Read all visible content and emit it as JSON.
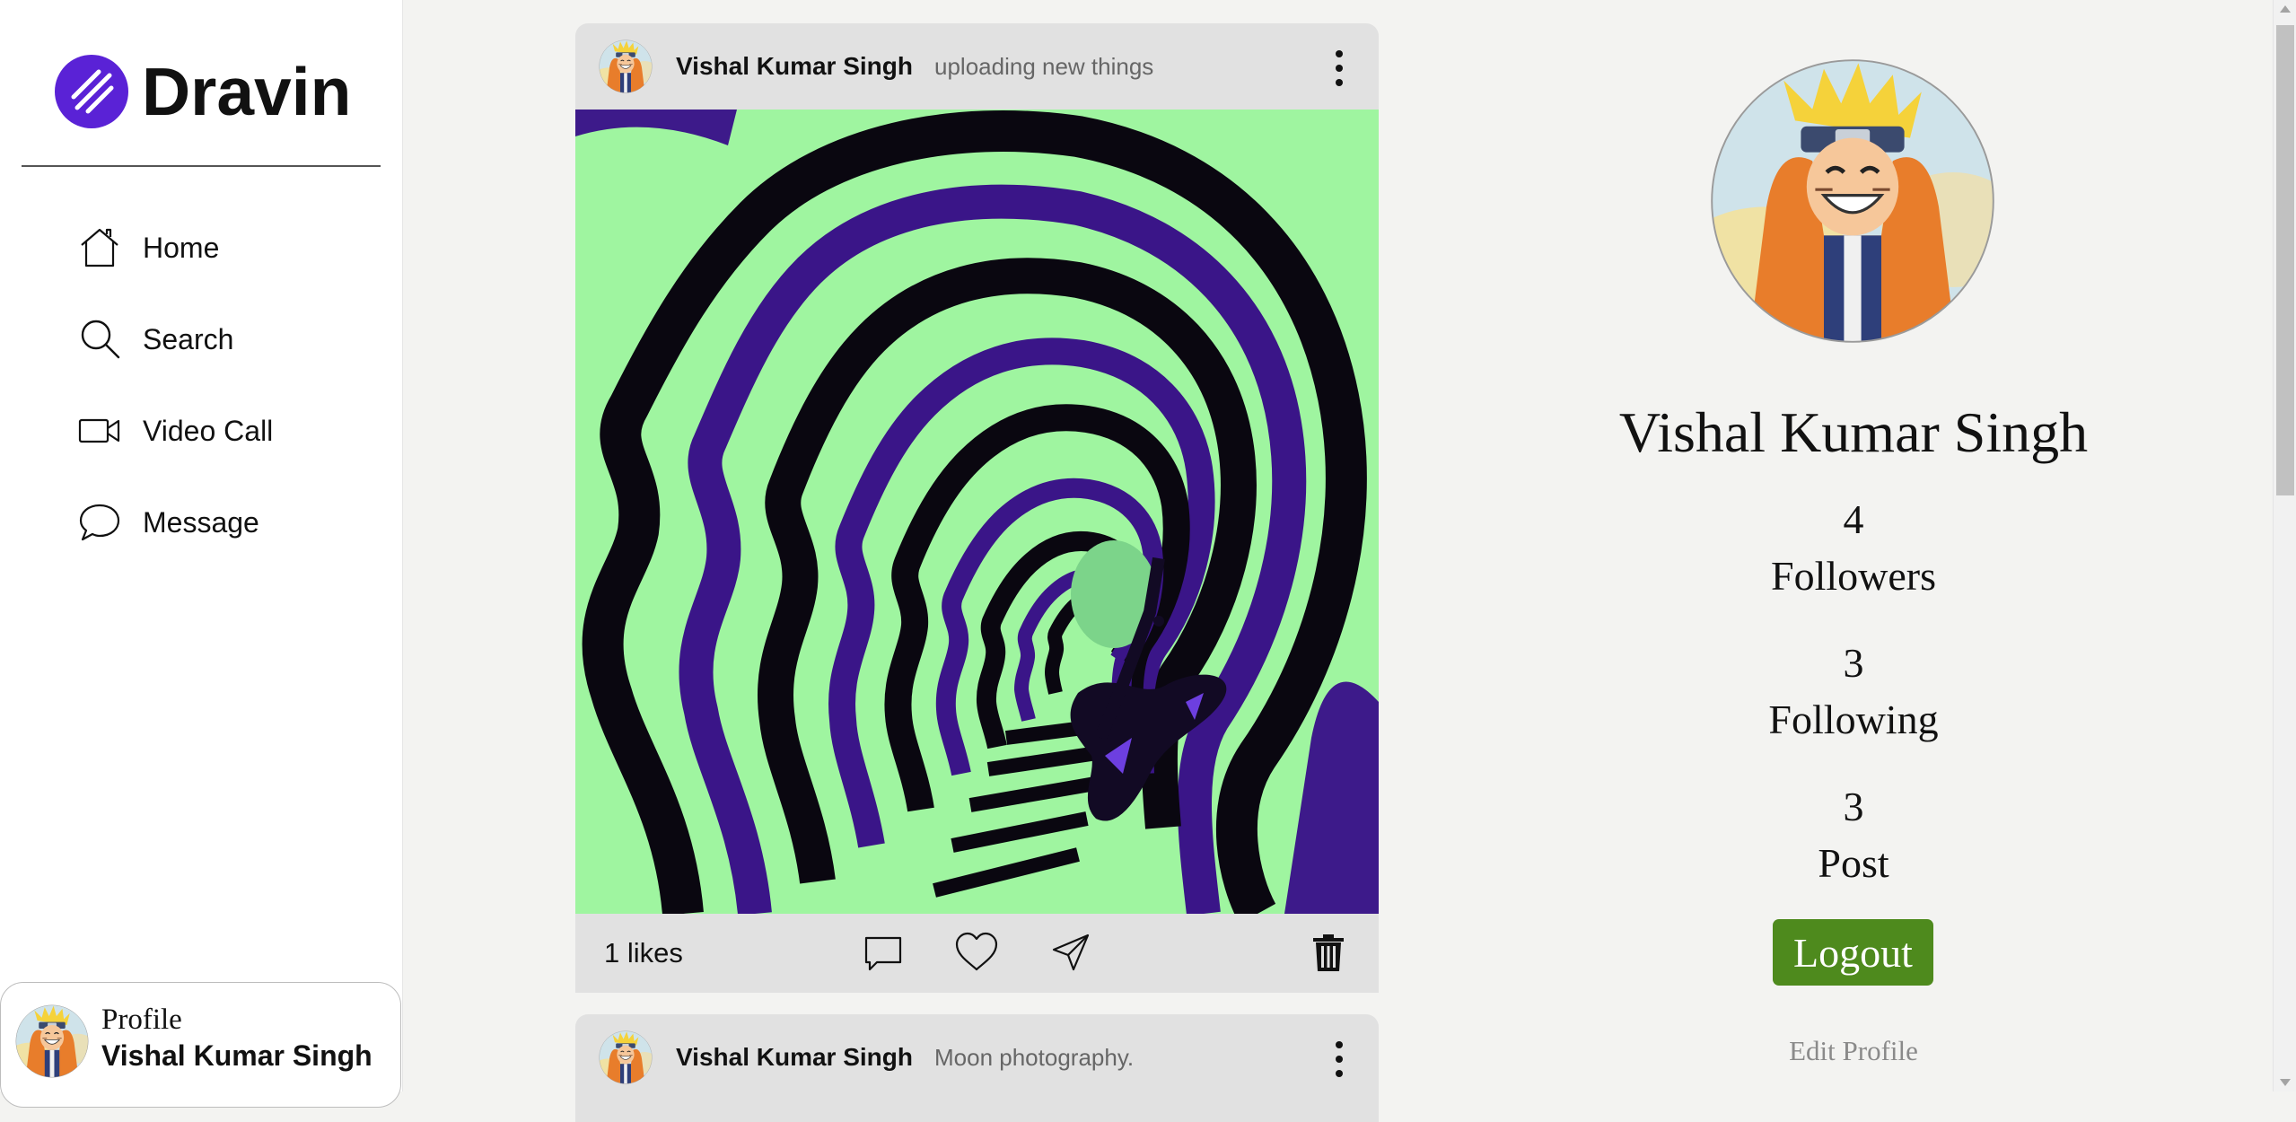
{
  "app": {
    "brand": "Dravin",
    "brand_color": "#5a22d6"
  },
  "sidebar": {
    "items": [
      {
        "icon": "home-icon",
        "label": "Home"
      },
      {
        "icon": "search-icon",
        "label": "Search"
      },
      {
        "icon": "video-call-icon",
        "label": "Video Call"
      },
      {
        "icon": "message-icon",
        "label": "Message"
      }
    ],
    "profile_card": {
      "label": "Profile",
      "name": "Vishal Kumar Singh"
    }
  },
  "feed": {
    "posts": [
      {
        "author": "Vishal Kumar Singh",
        "caption": "uploading new things",
        "likes_text": "1 likes"
      },
      {
        "author": "Vishal Kumar Singh",
        "caption": "Moon photography."
      }
    ],
    "actions": [
      "comment-icon",
      "heart-icon",
      "share-icon",
      "trash-icon"
    ]
  },
  "profile_panel": {
    "name": "Vishal Kumar Singh",
    "stats": [
      {
        "value": "4",
        "label": "Followers"
      },
      {
        "value": "3",
        "label": "Following"
      },
      {
        "value": "3",
        "label": "Post"
      }
    ],
    "logout_label": "Logout",
    "logout_color": "#4e8a1d",
    "edit_label": "Edit Profile"
  }
}
